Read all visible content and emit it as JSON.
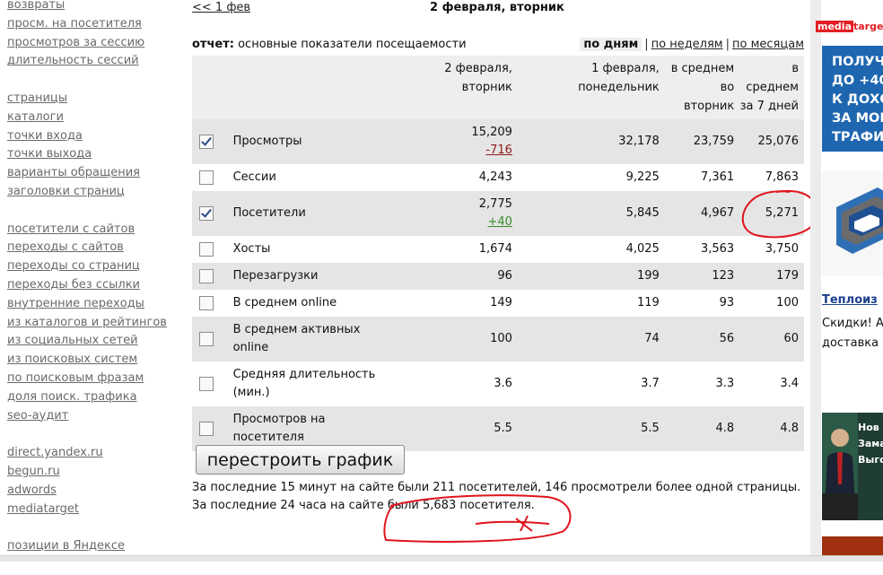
{
  "sidebar": {
    "groups": [
      [
        "возвраты",
        "просм. на посетителя",
        "просмотров за сессию",
        "длительность сессий"
      ],
      [
        "страницы",
        "каталоги",
        "точки входа",
        "точки выхода",
        "варианты обращения",
        "заголовки страниц"
      ],
      [
        "посетители с сайтов",
        "переходы с сайтов",
        "переходы со страниц",
        "переходы без ссылки",
        "внутренние переходы",
        "из каталогов и рейтингов",
        "из социальных сетей",
        "из поисковых систем",
        "по поисковым фразам",
        "доля поиск. трафика",
        "seo-аудит"
      ],
      [
        "direct.yandex.ru",
        "begun.ru",
        "adwords",
        "mediatarget"
      ],
      [
        "позиции в Яндексе"
      ]
    ]
  },
  "nav": {
    "prev": "<< 1 фев",
    "title": "2 февраля, вторник"
  },
  "report": {
    "label": "отчет:",
    "name": "основные показатели посещаемости",
    "periods": {
      "active": "по дням",
      "weeks": "по неделям",
      "months": "по месяцам",
      "separator": "|"
    }
  },
  "table": {
    "headers": [
      [
        "2 февраля,",
        "вторник"
      ],
      [
        "1 февраля,",
        "понедельник"
      ],
      [
        "в среднем",
        "во",
        "вторник"
      ],
      [
        "в",
        "среднем",
        "за 7 дней"
      ]
    ],
    "rows": [
      {
        "checked": true,
        "name": "Просмотры",
        "today": "15,209",
        "delta": "-716",
        "delta_sign": "neg",
        "yesterday": "32,178",
        "avg_day": "23,759",
        "avg_week": "25,076"
      },
      {
        "checked": false,
        "name": "Сессии",
        "today": "4,243",
        "yesterday": "9,225",
        "avg_day": "7,361",
        "avg_week": "7,863"
      },
      {
        "checked": true,
        "name": "Посетители",
        "today": "2,775",
        "delta": "+40",
        "delta_sign": "pos",
        "yesterday": "5,845",
        "avg_day": "4,967",
        "avg_week": "5,271"
      },
      {
        "checked": false,
        "name": "Хосты",
        "today": "1,674",
        "yesterday": "4,025",
        "avg_day": "3,563",
        "avg_week": "3,750"
      },
      {
        "checked": false,
        "name": "Перезагрузки",
        "today": "96",
        "yesterday": "199",
        "avg_day": "123",
        "avg_week": "179"
      },
      {
        "checked": false,
        "name": "В среднем online",
        "today": "149",
        "yesterday": "119",
        "avg_day": "93",
        "avg_week": "100"
      },
      {
        "checked": false,
        "name": "В среднем активных online",
        "today": "100",
        "yesterday": "74",
        "avg_day": "56",
        "avg_week": "60"
      },
      {
        "checked": false,
        "name": "Средняя длительность (мин.)",
        "today": "3.6",
        "yesterday": "3.7",
        "avg_day": "3.3",
        "avg_week": "3.4"
      },
      {
        "checked": false,
        "name": "Просмотров на посетителя",
        "today": "5.5",
        "yesterday": "5.5",
        "avg_day": "4.8",
        "avg_week": "4.8"
      }
    ]
  },
  "rebuild_button": "перестроить график",
  "summary": {
    "line1": "За последние 15 минут на сайте были 211 посетителей, 146 просмотрели более одной страницы.",
    "line2": "За последние 24 часа на сайте были 5,683 посетителя."
  },
  "ads": {
    "logo_part1": "media",
    "logo_part2": "targe",
    "banner1_lines": [
      "ПОЛУЧ",
      "ДО +40",
      "К ДОХО",
      "ЗА МОБ",
      "ТРАФИ"
    ],
    "ad_title": "Теплоиз",
    "ad_text_lines": [
      "Скидки! А",
      "доставка"
    ],
    "banner3_lines": [
      "Нов",
      "Заманч",
      "Выгод"
    ]
  },
  "colors": {
    "annotation": "#e0141c",
    "row_shade": "#e5e5e5",
    "header_bg": "#eeeeee",
    "delta_negative": "#8b1c1c",
    "delta_positive": "#3a8a2a"
  }
}
